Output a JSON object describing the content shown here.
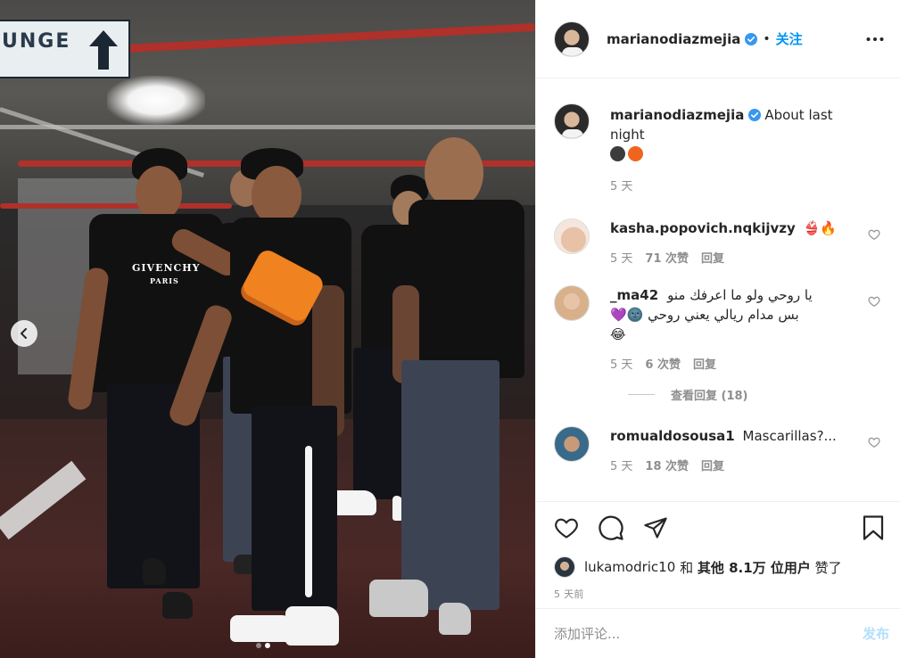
{
  "photo": {
    "sign_text": "UNGE",
    "shirt_text": "GIVENCHY",
    "shirt_subtext": "PARIS",
    "carousel_total": 2,
    "carousel_active": 2
  },
  "header": {
    "username": "marianodiazmejia",
    "separator": "•",
    "follow_label": "关注"
  },
  "caption": {
    "username": "marianodiazmejia",
    "text": "About last night",
    "emoji_colors": [
      "#3c3c3c",
      "#f0641e"
    ],
    "time": "5 天"
  },
  "comments": [
    {
      "username": "kasha.popovich.nqkijvzy",
      "text": "👙🔥",
      "time": "5 天",
      "likes": "71 次赞",
      "reply": "回复"
    },
    {
      "username": "_ma42",
      "text": "يا روحي ولو ما اعرفك منو",
      "text2": "بس مدام ريالي يعني روحي 🌚💜",
      "text3": "😂",
      "time": "5 天",
      "likes": "6 次赞",
      "reply": "回复",
      "view_replies": "查看回复 (18)"
    },
    {
      "username": "romualdosousa1",
      "text": "Mascarillas?...",
      "time": "5 天",
      "likes": "18 次赞",
      "reply": "回复"
    }
  ],
  "likes": {
    "username": "lukamodric10",
    "and": "和",
    "others": "其他 8.1万 位用户",
    "liked": "赞了"
  },
  "timestamp": "5 天前",
  "add_comment": {
    "placeholder": "添加评论...",
    "post_label": "发布"
  },
  "colors": {
    "accent": "#0095f6",
    "muted": "#8e8e8e",
    "post_disabled": "#b2dffc"
  }
}
